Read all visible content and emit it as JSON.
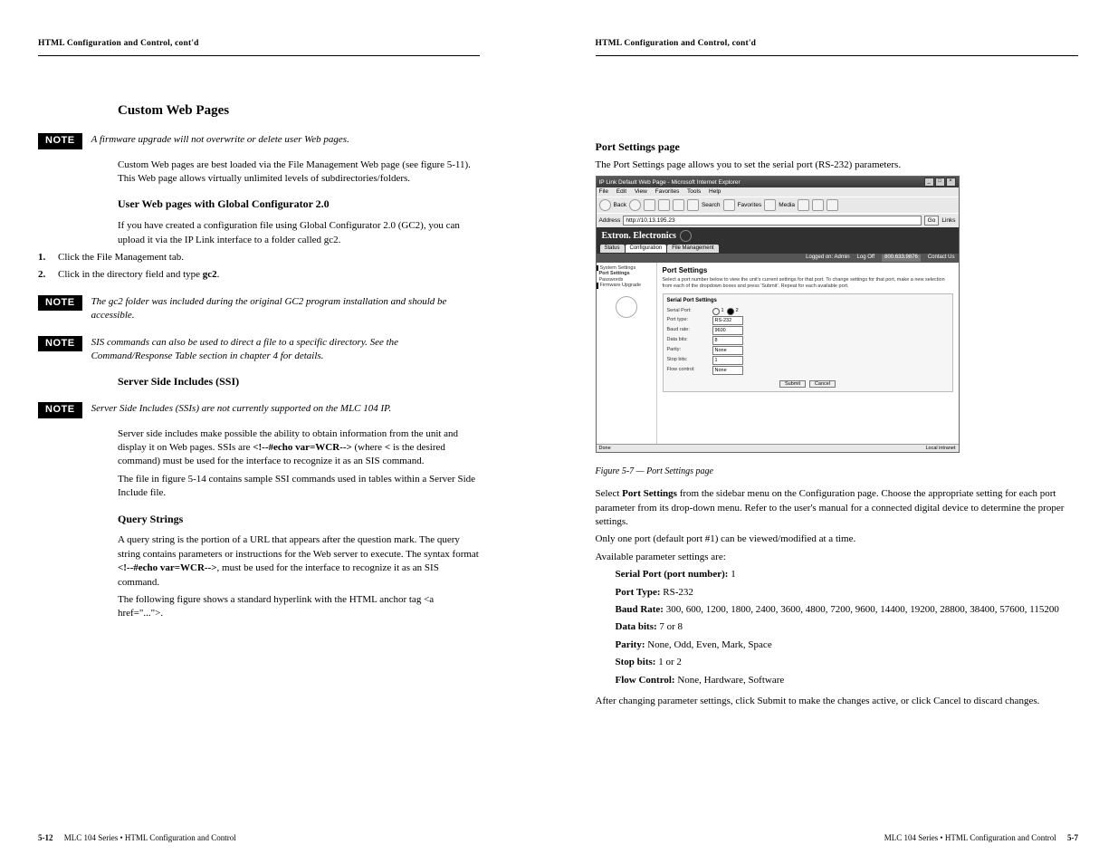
{
  "left": {
    "running_head": "HTML Configuration and Control, cont'd",
    "section_title": "Custom Web Pages",
    "note1": "A firmware upgrade will not overwrite or delete user Web pages.",
    "p1": "Custom Web pages are best loaded via the File Management Web page (see figure 5-11). This Web page allows virtually unlimited levels of subdirectories/folders.",
    "uwp_title": "User Web pages with Global Configurator 2.0",
    "uwp_p1": "If you have created a configuration file using Global Configurator 2.0 (GC2), you can upload it via the IP Link interface to a folder called gc2.",
    "uwp_step1_num": "1.",
    "uwp_step1": "Click the File Management tab.",
    "uwp_step2_num": "2.",
    "uwp_step2_a": "Click in the directory field and type ",
    "uwp_step2_b": "gc2",
    "uwp_step2_c": ".",
    "note2": "The gc2 folder was included during the original GC2 program installation and should be accessible.",
    "note3": "SIS commands can also be used to direct a file to a specific directory. See the Command/Response Table section in chapter 4 for details.",
    "swp_title": "Server Side Includes (SSI)",
    "note4": "Server Side Includes (SSIs) are not currently supported on the MLC 104 IP.",
    "p2a": "Server side includes make possible the ability to obtain information from the unit and display it on Web pages. SSIs are ",
    "p2b": "<!--#echo var=WCR-->",
    "p2c": " (where ",
    "p2d": "<",
    "p2e": " is the desired command) must be used for the interface to recognize it as an SIS command.",
    "p3a": "The ",
    "p3b": " file in figure 5-14 contains sample SSI commands used in tables within a Server Side Include file.",
    "qs_title": "Query Strings",
    "qs_p1a": "A query string is the portion of a URL that appears after the question mark. The query string contains parameters or instructions for the Web server to execute. The syntax format ",
    "qs_p1b": "<!--#echo var=WCR-->",
    "qs_p1c": ", must be used for the interface to recognize it as an SIS command.",
    "qs_p2": "The following figure shows a standard hyperlink with the HTML anchor tag <a href=\"...\">.",
    "footer_page": "5-12",
    "footer_text": "MLC 104 Series • HTML Configuration and Control"
  },
  "right": {
    "running_head": "HTML Configuration and Control, cont'd",
    "subsection": "Port Settings page",
    "p1": "The Port Settings page allows you to set the serial port (RS-232) parameters.",
    "caption": "Figure 5-7 — Port Settings page",
    "p2a": "Select ",
    "p2b": "Port Settings",
    "p2c": " from the sidebar menu on the Configuration page. Choose the appropriate setting for each port parameter from its drop-down menu. Refer to the user's manual for a connected digital device to determine the proper settings.",
    "p3": "Only one port (default port #1) can be viewed/modified at a time.",
    "available": "Available parameter settings are:",
    "param_port_label": "Serial Port (port number):",
    "param_port_vals": " 1",
    "param_type_label": "Port Type:",
    "param_type_vals": " RS-232",
    "param_baud_label": "Baud Rate:",
    "param_baud_vals": " 300, 600, 1200, 1800, 2400, 3600, 4800, 7200, 9600, 14400, 19200, 28800, 38400, 57600, 115200",
    "param_data_label": "Data bits:",
    "param_data_vals": " 7 or 8",
    "param_parity_label": "Parity:",
    "param_parity_vals": " None, Odd, Even, Mark, Space",
    "param_stop_label": "Stop bits:",
    "param_stop_vals": " 1 or 2",
    "param_flow_label": "Flow Control:",
    "param_flow_vals": " None, Hardware, Software",
    "after_p": "After changing parameter settings, click Submit to make the changes active, or click Cancel to discard changes.",
    "footer_text": "MLC 104 Series • HTML Configuration and Control",
    "footer_page": "5-7"
  },
  "shot": {
    "title": "IP Link Default Web Page - Microsoft Internet Explorer",
    "menu": [
      "File",
      "Edit",
      "View",
      "Favorites",
      "Tools",
      "Help"
    ],
    "toolbar_labels": [
      "Back",
      "Search",
      "Favorites",
      "Media"
    ],
    "addr_label": "Address",
    "addr_value": "http://10.13.195.23",
    "go": "Go",
    "links": "Links",
    "brand": "Extron. Electronics",
    "tabs": [
      "Status",
      "Configuration",
      "File Management"
    ],
    "logged_on": "Logged on: Admin",
    "logoff": "Log Off",
    "phone": "800.633.9876",
    "contact": "Contact Us",
    "side_items": [
      "System Settings",
      "Port Settings",
      "Passwords",
      "Firmware Upgrade"
    ],
    "page_title": "Port Settings",
    "page_desc": "Select a port number below to view the unit's current settings for that port. To change settings for that port, make a new selection from each of the dropdown boxes and press 'Submit'. Repeat for each available port.",
    "panel_title": "Serial Port Settings",
    "rows": {
      "serial_port": "Serial Port:",
      "serial_port_1": "1",
      "serial_port_2": "2",
      "port_type": "Port type:",
      "port_type_v": "RS-232",
      "baud": "Baud rate:",
      "baud_v": "9600",
      "data": "Data bits:",
      "data_v": "8",
      "parity": "Parity:",
      "parity_v": "None",
      "stop": "Stop bits:",
      "stop_v": "1",
      "flow": "Flow control:",
      "flow_v": "None"
    },
    "submit": "Submit",
    "cancel": "Cancel",
    "status_left": "Done",
    "status_right": "Local intranet"
  }
}
